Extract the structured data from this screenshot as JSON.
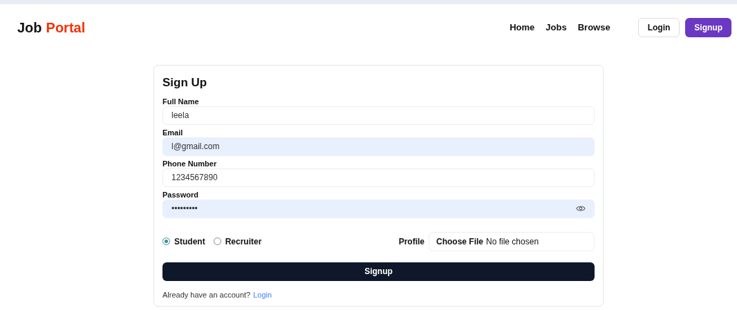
{
  "navbar": {
    "logo": {
      "part1": "Job",
      "part2": "Portal"
    },
    "links": [
      {
        "label": "Home"
      },
      {
        "label": "Jobs"
      },
      {
        "label": "Browse"
      }
    ],
    "buttons": [
      {
        "label": "Login",
        "kind": "outline"
      },
      {
        "label": "Signup",
        "kind": "primary"
      }
    ]
  },
  "form": {
    "title": "Sign Up",
    "fields": [
      {
        "label": "Full Name",
        "value": "leela",
        "autofilled": false,
        "kind": "text"
      },
      {
        "label": "Email",
        "value": "l@gmail.com",
        "autofilled": true,
        "kind": "text"
      },
      {
        "label": "Phone Number",
        "value": "1234567890",
        "autofilled": false,
        "kind": "text"
      },
      {
        "label": "Password",
        "value": "•••••••••",
        "autofilled": true,
        "kind": "password"
      }
    ],
    "roles": [
      {
        "label": "Student",
        "selected": true
      },
      {
        "label": "Recruiter",
        "selected": false
      }
    ],
    "profile": {
      "label": "Profile",
      "button": "Choose File",
      "status": "No file chosen"
    },
    "submit": "Signup",
    "footer": {
      "text": "Already have an account?",
      "link": "Login"
    }
  }
}
